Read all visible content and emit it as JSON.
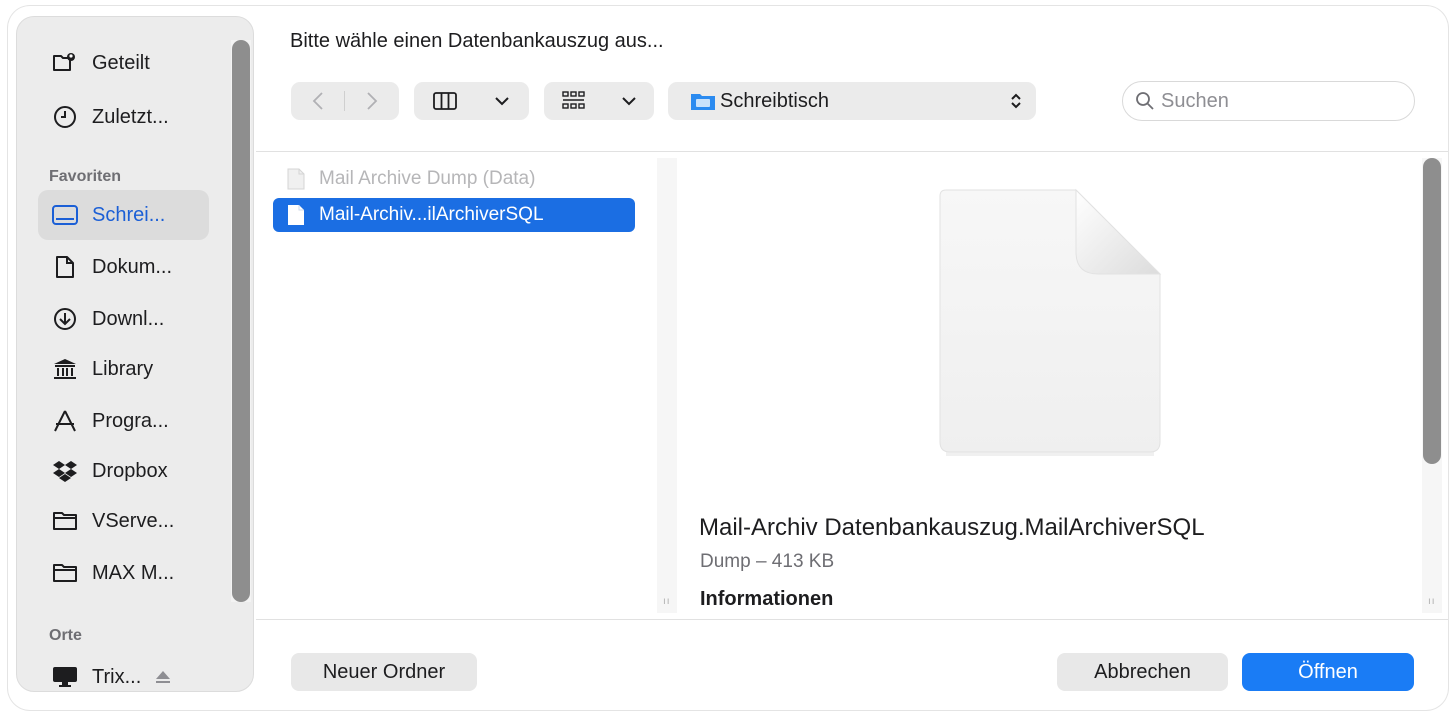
{
  "dialog_title": "Bitte wähle einen Datenbankauszug aus...",
  "sidebar": {
    "top_items": [
      {
        "label": "Geteilt",
        "icon": "shared-folder-icon"
      },
      {
        "label": "Zuletzt...",
        "icon": "clock-icon"
      }
    ],
    "favorites_header": "Favoriten",
    "favorites": [
      {
        "label": "Schrei...",
        "icon": "desktop-icon",
        "active": true
      },
      {
        "label": "Dokum...",
        "icon": "document-icon"
      },
      {
        "label": "Downl...",
        "icon": "download-icon"
      },
      {
        "label": "Library",
        "icon": "library-icon"
      },
      {
        "label": "Progra...",
        "icon": "applications-icon"
      },
      {
        "label": "Dropbox",
        "icon": "dropbox-icon"
      },
      {
        "label": "VServe...",
        "icon": "folder-icon"
      },
      {
        "label": "MAX M...",
        "icon": "folder-icon"
      }
    ],
    "places_header": "Orte",
    "places": [
      {
        "label": "Trix...",
        "icon": "computer-icon",
        "eject_icon": "eject-icon"
      }
    ]
  },
  "toolbar": {
    "back_icon": "chevron-left-icon",
    "forward_icon": "chevron-right-icon",
    "view_icon": "column-view-icon",
    "group_icon": "grid-icon",
    "location": {
      "label": "Schreibtisch",
      "icon": "desktop-folder-icon"
    },
    "search_placeholder": "Suchen"
  },
  "files": [
    {
      "name": "Mail Archive Dump (Data)",
      "state": "disabled"
    },
    {
      "name": "Mail-Archiv...ilArchiverSQL",
      "state": "selected"
    }
  ],
  "preview": {
    "file_name": "Mail-Archiv Datenbankauszug.MailArchiverSQL",
    "meta": "Dump – 413 KB",
    "info_header": "Informationen"
  },
  "footer": {
    "new_folder": "Neuer Ordner",
    "cancel": "Abbrechen",
    "open": "Öffnen"
  },
  "colors": {
    "accent": "#1a7cf5",
    "selection": "#1b6ee3",
    "sidebar_active_text": "#1b5fd6"
  }
}
